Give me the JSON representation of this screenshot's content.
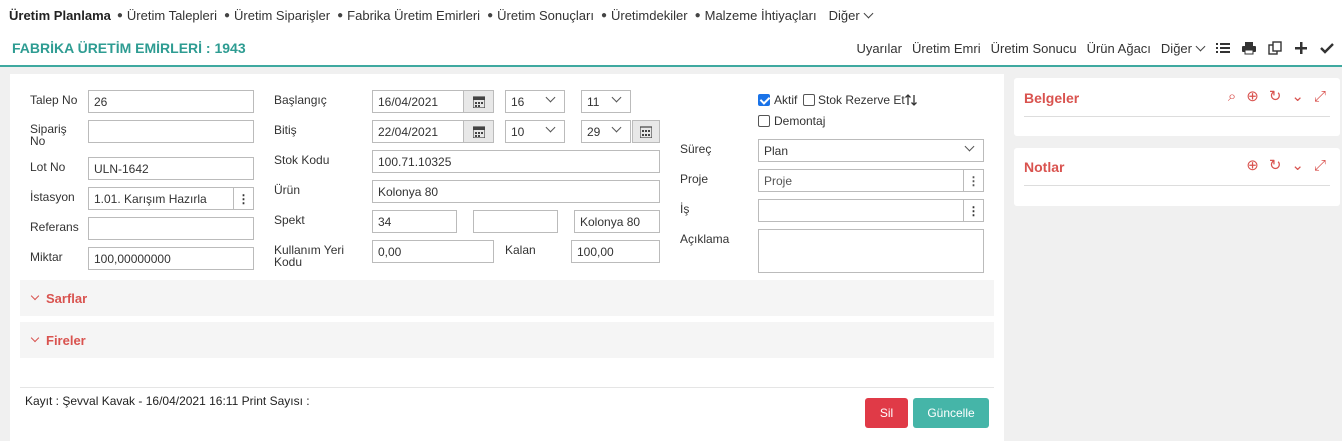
{
  "topnav": {
    "brand": "Üretim Planlama",
    "items": [
      "Üretim Talepleri",
      "Üretim Siparişler",
      "Fabrika Üretim Emirleri",
      "Üretim Sonuçları",
      "Üretimdekiler",
      "Malzeme İhtiyaçları"
    ],
    "more": "Diğer"
  },
  "titlebar": {
    "title": "FABRİKA ÜRETİM EMİRLERİ : 1943",
    "actions": [
      "Uyarılar",
      "Üretim Emri",
      "Üretim Sonucu",
      "Ürün Ağacı"
    ],
    "more": "Diğer"
  },
  "form": {
    "talep_no": {
      "label": "Talep No",
      "value": "26"
    },
    "siparis_no": {
      "label": "Sipariş No",
      "value": ""
    },
    "lot_no": {
      "label": "Lot No",
      "value": "ULN-1642"
    },
    "istasyon": {
      "label": "İstasyon",
      "value": "1.01. Karışım Hazırla"
    },
    "referans": {
      "label": "Referans",
      "value": ""
    },
    "miktar": {
      "label": "Miktar",
      "value": "100,00000000"
    },
    "baslangic": {
      "label": "Başlangıç",
      "date": "16/04/2021",
      "hour": "16",
      "minute": "11"
    },
    "bitis": {
      "label": "Bitiş",
      "date": "22/04/2021",
      "hour": "10",
      "minute": "29"
    },
    "stok_kodu": {
      "label": "Stok Kodu",
      "value": "100.71.10325"
    },
    "urun": {
      "label": "Ürün",
      "value": "Kolonya 80"
    },
    "spekt": {
      "label": "Spekt",
      "value1": "34",
      "value2": "",
      "value3": "Kolonya 80"
    },
    "kullanim_yeri": {
      "label_line1": "Kullanım Yeri",
      "label_line2": "Kodu",
      "value": "0,00"
    },
    "kalan": {
      "label": "Kalan",
      "value": "100,00"
    },
    "aktif": {
      "label": "Aktif",
      "checked": true
    },
    "stok_rezerve": {
      "label": "Stok Rezerve Et",
      "checked": false
    },
    "demontaj": {
      "label": "Demontaj",
      "checked": false
    },
    "surec": {
      "label": "Süreç",
      "value": "Plan"
    },
    "proje": {
      "label": "Proje",
      "placeholder": "Proje"
    },
    "is": {
      "label": "İş",
      "value": ""
    },
    "aciklama": {
      "label": "Açıklama",
      "value": ""
    }
  },
  "sections": {
    "sarflar": "Sarflar",
    "fireler": "Fireler"
  },
  "footer": {
    "kayit": "Kayıt : Şevval Kavak - 16/04/2021 16:11 Print Sayısı :",
    "delete_label": "Sil",
    "update_label": "Güncelle"
  },
  "right": {
    "belgeler": "Belgeler",
    "notlar": "Notlar"
  },
  "colors": {
    "accent": "#2e9c92",
    "danger": "#e03a47",
    "update": "#45b5a8",
    "section_title": "#d9534f"
  }
}
